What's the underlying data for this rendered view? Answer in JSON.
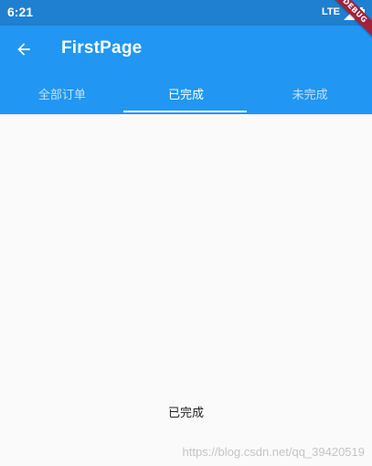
{
  "status_bar": {
    "time": "6:21",
    "network": "LTE",
    "icons": [
      "signal-icon",
      "battery-icon"
    ]
  },
  "app_bar": {
    "title": "FirstPage",
    "back_icon": "arrow-back-icon",
    "background_color": "#2196f3"
  },
  "debug_banner": "DEBUG",
  "tabs": [
    {
      "label": "全部订单",
      "selected": false
    },
    {
      "label": "已完成",
      "selected": true
    },
    {
      "label": "未完成",
      "selected": false
    }
  ],
  "content": {
    "text": "已完成"
  },
  "watermark": "https://blog.csdn.net/qq_39420519"
}
